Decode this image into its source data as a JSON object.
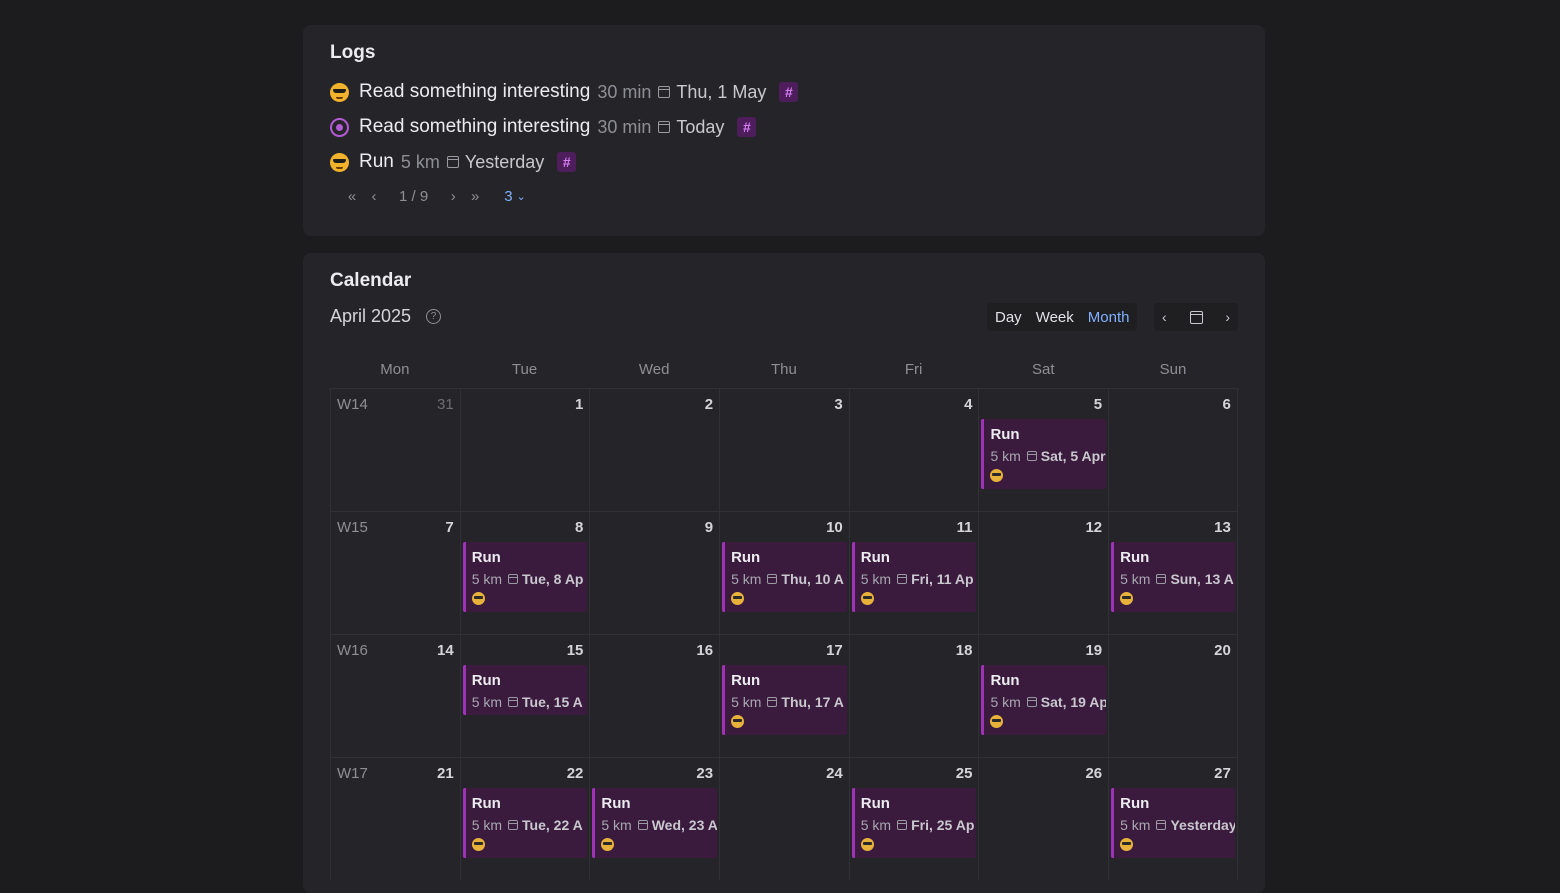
{
  "logs": {
    "title": "Logs",
    "items": [
      {
        "icon": "sunglasses-emoji",
        "title": "Read something interesting",
        "meta": "30 min",
        "date": "Thu, 1 May",
        "tag": "#"
      },
      {
        "icon": "in-progress-icon",
        "title": "Read something interesting",
        "meta": "30 min",
        "date": "Today",
        "tag": "#"
      },
      {
        "icon": "sunglasses-emoji",
        "title": "Run",
        "meta": "5 km",
        "date": "Yesterday",
        "tag": "#"
      }
    ],
    "pager": {
      "first": "«",
      "prev": "‹",
      "page": "1 / 9",
      "next": "›",
      "last": "»",
      "page_size": "3"
    }
  },
  "calendar": {
    "title": "Calendar",
    "month_label": "April 2025",
    "views": [
      "Day",
      "Week",
      "Month"
    ],
    "active_view": "Month",
    "weekdays": [
      "Mon",
      "Tue",
      "Wed",
      "Thu",
      "Fri",
      "Sat",
      "Sun"
    ],
    "weeks": [
      {
        "label": "W14",
        "days": [
          {
            "num": "31",
            "dim": true
          },
          {
            "num": "1"
          },
          {
            "num": "2"
          },
          {
            "num": "3"
          },
          {
            "num": "4"
          },
          {
            "num": "5",
            "event": {
              "title": "Run",
              "meta": "5 km",
              "date": "Sat, 5 Apr"
            }
          },
          {
            "num": "6"
          }
        ]
      },
      {
        "label": "W15",
        "days": [
          {
            "num": "7"
          },
          {
            "num": "8",
            "event": {
              "title": "Run",
              "meta": "5 km",
              "date": "Tue, 8 Ap"
            }
          },
          {
            "num": "9"
          },
          {
            "num": "10",
            "event": {
              "title": "Run",
              "meta": "5 km",
              "date": "Thu, 10 A"
            }
          },
          {
            "num": "11",
            "event": {
              "title": "Run",
              "meta": "5 km",
              "date": "Fri, 11 Ap"
            }
          },
          {
            "num": "12"
          },
          {
            "num": "13",
            "event": {
              "title": "Run",
              "meta": "5 km",
              "date": "Sun, 13 A"
            }
          }
        ]
      },
      {
        "label": "W16",
        "days": [
          {
            "num": "14"
          },
          {
            "num": "15",
            "event": {
              "title": "Run",
              "meta": "5 km",
              "date": "Tue, 15 A",
              "short": true
            }
          },
          {
            "num": "16"
          },
          {
            "num": "17",
            "event": {
              "title": "Run",
              "meta": "5 km",
              "date": "Thu, 17 A"
            }
          },
          {
            "num": "18"
          },
          {
            "num": "19",
            "event": {
              "title": "Run",
              "meta": "5 km",
              "date": "Sat, 19 Ap"
            }
          },
          {
            "num": "20"
          }
        ]
      },
      {
        "label": "W17",
        "days": [
          {
            "num": "21"
          },
          {
            "num": "22",
            "event": {
              "title": "Run",
              "meta": "5 km",
              "date": "Tue, 22 A"
            }
          },
          {
            "num": "23",
            "event": {
              "title": "Run",
              "meta": "5 km",
              "date": "Wed, 23 A"
            }
          },
          {
            "num": "24"
          },
          {
            "num": "25",
            "event": {
              "title": "Run",
              "meta": "5 km",
              "date": "Fri, 25 Ap"
            }
          },
          {
            "num": "26"
          },
          {
            "num": "27",
            "event": {
              "title": "Run",
              "meta": "5 km",
              "date": "Yesterday"
            }
          }
        ]
      }
    ]
  }
}
